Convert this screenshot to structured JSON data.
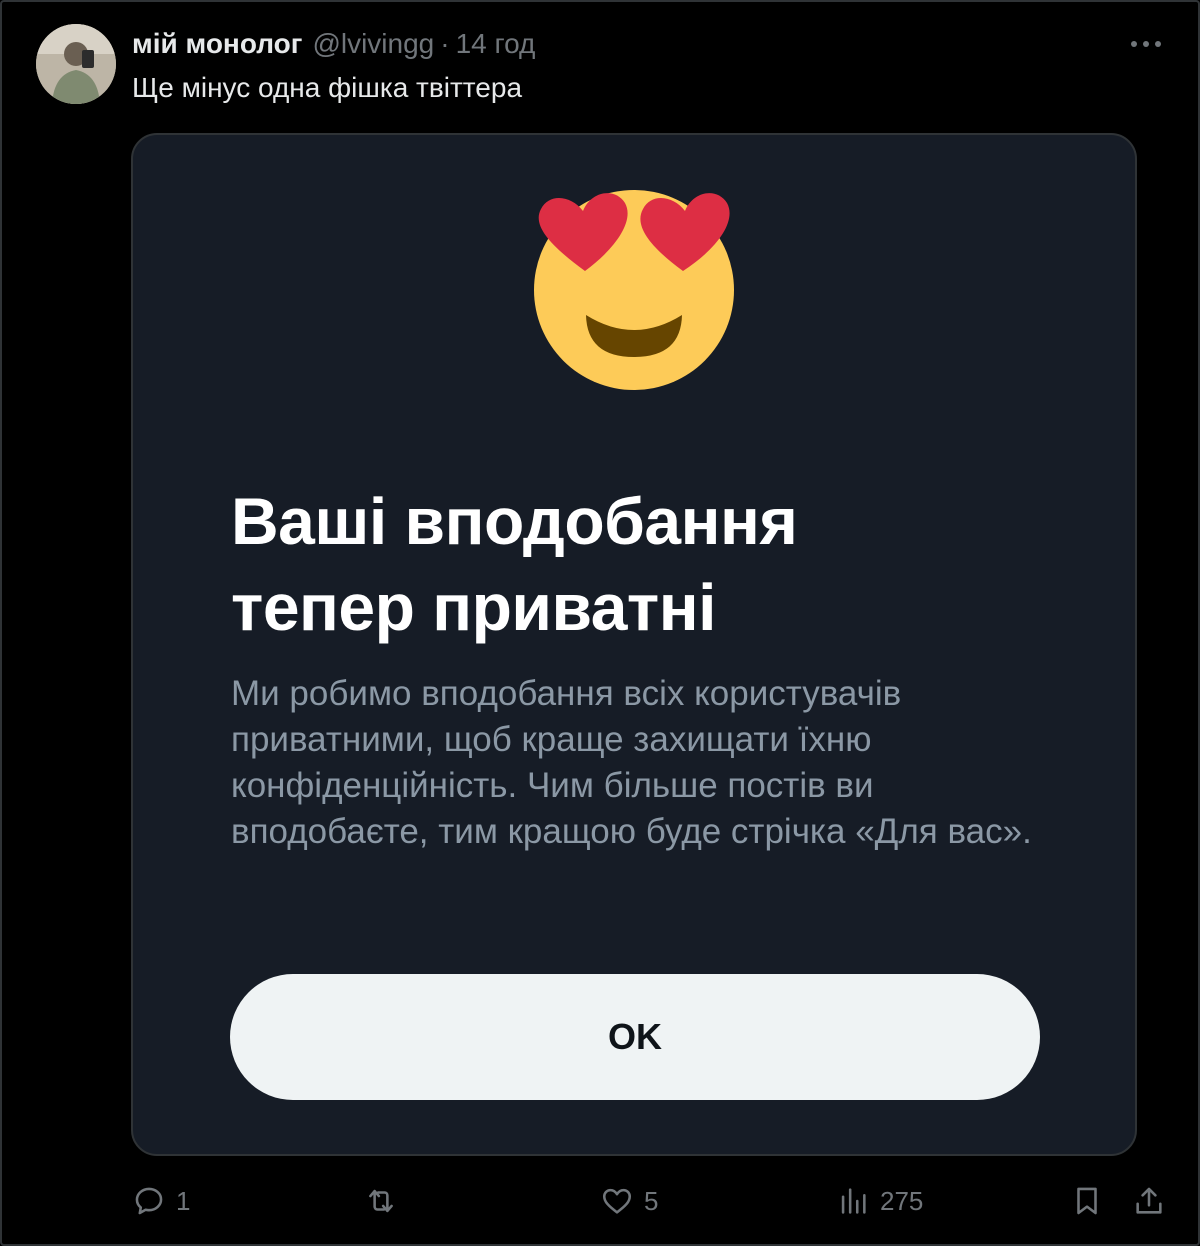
{
  "tweet": {
    "author_name": "мій монолог",
    "author_handle": "@lvivingg",
    "separator": "·",
    "time": "14 год",
    "text": "Ще мінус одна фішка твіттера"
  },
  "card": {
    "title_line1": "Ваші вподобання",
    "title_line2": "тепер приватні",
    "body": "Ми робимо вподобання всіх користувачів приватними, щоб краще захищати їхню конфіденційність. Чим більше постів ви вподобаєте, тим кращою буде стрічка «Для вас».",
    "button_label": "OK",
    "emoji": "smiling-face-with-heart-eyes"
  },
  "actions": {
    "replies": "1",
    "retweets": "",
    "likes": "5",
    "views": "275"
  },
  "colors": {
    "background": "#000000",
    "card_background": "#161c26",
    "muted_text": "#71767b",
    "button_background": "#eff3f4"
  }
}
